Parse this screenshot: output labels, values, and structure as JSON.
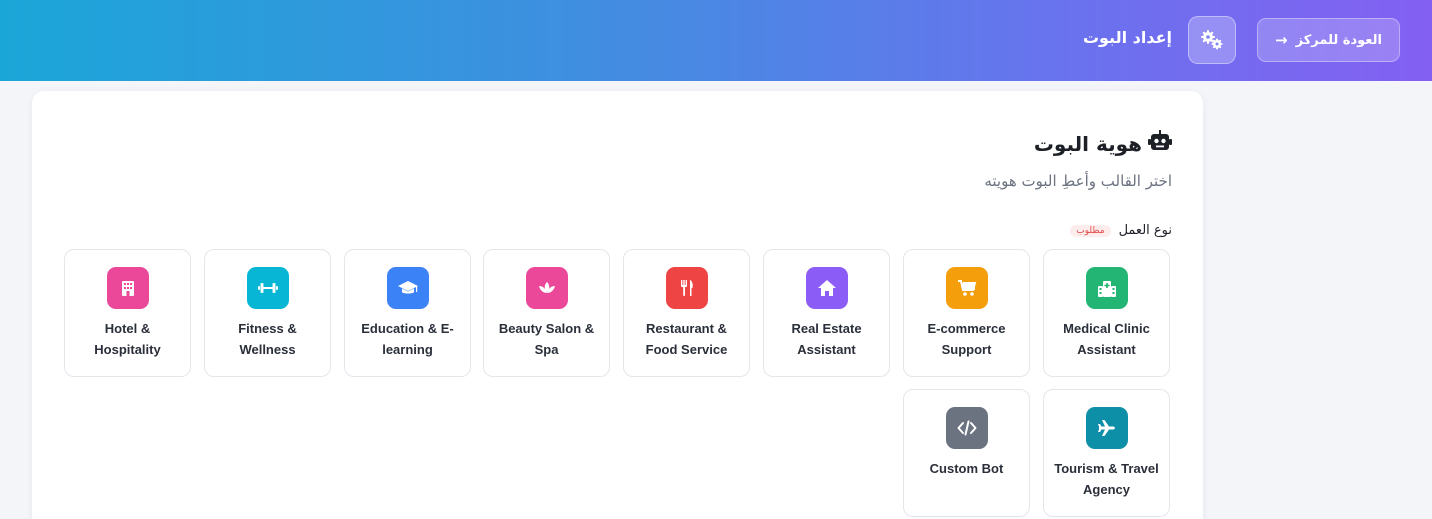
{
  "header": {
    "back_label": "العودة للمركز",
    "back_arrow": "→",
    "settings_icon": "gears-icon",
    "title": "إعداد البوت",
    "gradient": [
      "#1ba6d8",
      "#3f8fe0",
      "#6a72ee",
      "#8360f2"
    ]
  },
  "identity": {
    "title": "هوية البوت",
    "title_icon": "robot-icon",
    "subtitle": "اختر القالب وأعطِ البوت هويته",
    "business_type_label": "نوع العمل",
    "required_badge": "مطلوب"
  },
  "business_types": [
    {
      "label_line1": "Medical Clinic",
      "label_line2": "Assistant",
      "icon": "hospital-icon",
      "color": "#22b573"
    },
    {
      "label_line1": "E-commerce",
      "label_line2": "Support",
      "icon": "cart-icon",
      "color": "#f59e0b"
    },
    {
      "label_line1": "Real Estate",
      "label_line2": "Assistant",
      "icon": "home-icon",
      "color": "#8b5cf6"
    },
    {
      "label_line1": "Restaurant &",
      "label_line2": "Food Service",
      "icon": "utensils-icon",
      "color": "#ef4444"
    },
    {
      "label_line1": "Beauty Salon &",
      "label_line2": "Spa",
      "icon": "lotus-icon",
      "color": "#ec4899"
    },
    {
      "label_line1": "Education & E-",
      "label_line2": "learning",
      "icon": "graduation-cap-icon",
      "color": "#3b82f6"
    },
    {
      "label_line1": "Fitness &",
      "label_line2": "Wellness",
      "icon": "dumbbell-icon",
      "color": "#06b6d4"
    },
    {
      "label_line1": "Hotel &",
      "label_line2": "Hospitality",
      "icon": "hotel-icon",
      "color": "#ec4899"
    },
    {
      "label_line1": "Tourism & Travel",
      "label_line2": "Agency",
      "icon": "plane-icon",
      "color": "#0e8fa8"
    },
    {
      "label_line1": "Custom Bot",
      "label_line2": "",
      "icon": "code-icon",
      "color": "#6b7280"
    }
  ]
}
